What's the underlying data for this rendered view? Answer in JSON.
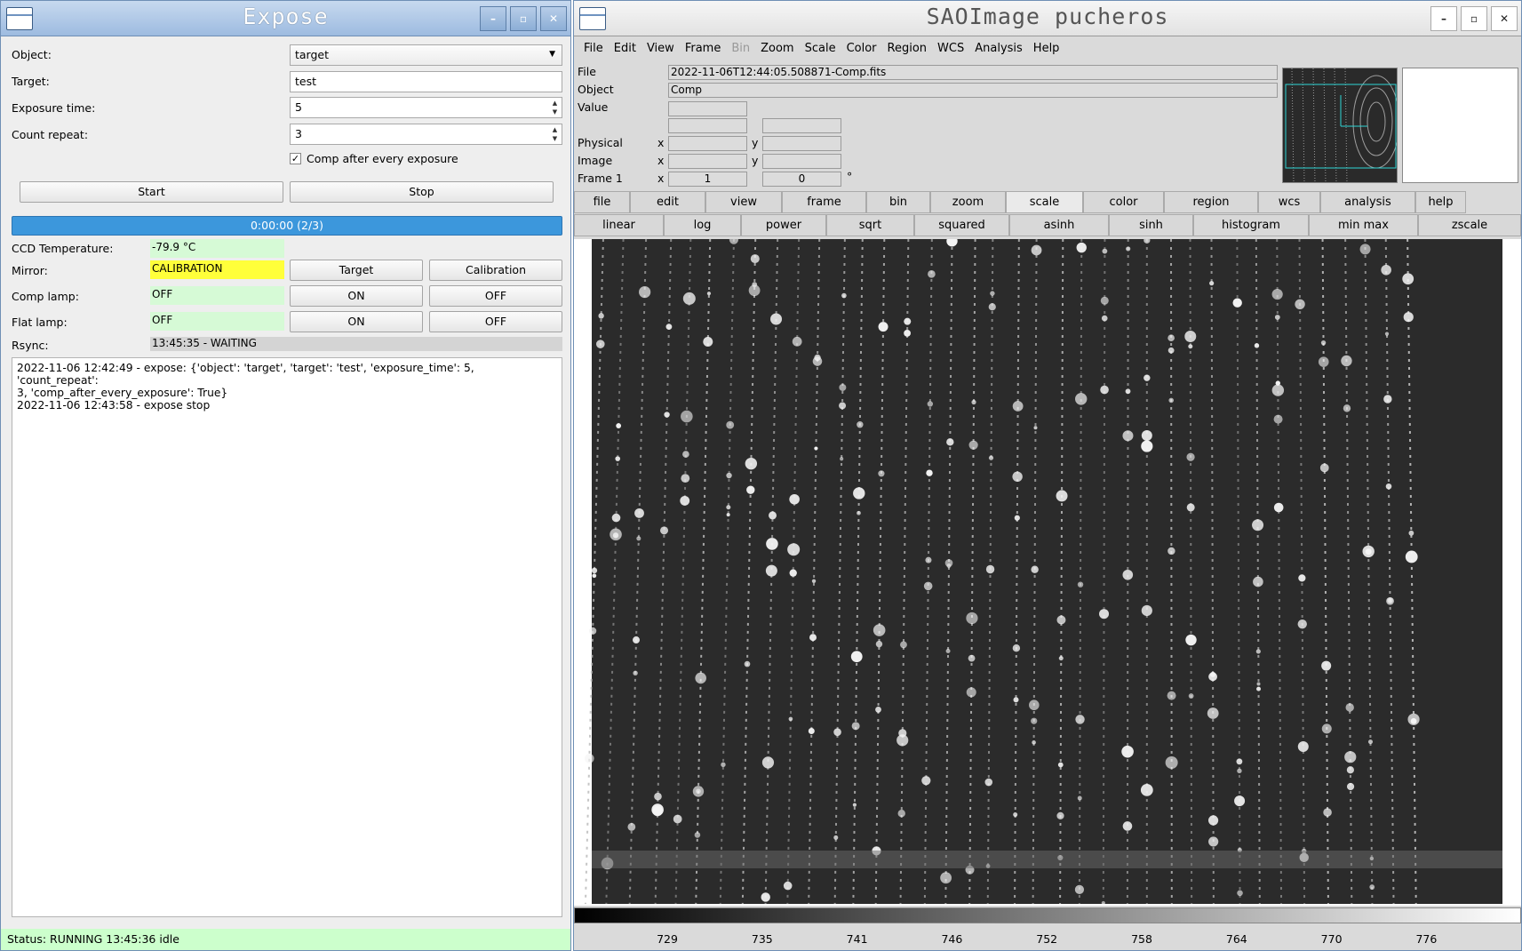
{
  "expose": {
    "title": "Expose",
    "form": {
      "object_label": "Object:",
      "object_value": "target",
      "target_label": "Target:",
      "target_value": "test",
      "exposure_label": "Exposure time:",
      "exposure_value": "5",
      "count_label": "Count repeat:",
      "count_value": "3",
      "comp_label": "Comp after every exposure",
      "comp_checked": true
    },
    "start_label": "Start",
    "stop_label": "Stop",
    "progress_text": "0:00:00 (2/3)",
    "progress_fraction": 1.0,
    "status_rows": {
      "ccd_label": "CCD Temperature:",
      "ccd_value": "-79.9 °C",
      "mirror_label": "Mirror:",
      "mirror_value": "CALIBRATION",
      "mirror_btn1": "Target",
      "mirror_btn2": "Calibration",
      "comp_label": "Comp lamp:",
      "comp_value": "OFF",
      "comp_on": "ON",
      "comp_off": "OFF",
      "flat_label": "Flat lamp:",
      "flat_value": "OFF",
      "flat_on": "ON",
      "flat_off": "OFF",
      "rsync_label": "Rsync:",
      "rsync_value": "13:45:35 - WAITING"
    },
    "log_text": "2022-11-06 12:42:49 - expose: {'object': 'target', 'target': 'test', 'exposure_time': 5, 'count_repeat':\n3, 'comp_after_every_exposure': True}\n2022-11-06 12:43:58 - expose stop",
    "status_bar": "Status: RUNNING 13:45:36 idle",
    "colors": {
      "progress": "#3c97dc",
      "green": "#d6fad6",
      "yellow": "#ffff3a"
    }
  },
  "ds9": {
    "title": "SAOImage pucheros",
    "menu": [
      "File",
      "Edit",
      "View",
      "Frame",
      "Bin",
      "Zoom",
      "Scale",
      "Color",
      "Region",
      "WCS",
      "Analysis",
      "Help"
    ],
    "menu_disabled": "Bin",
    "info": {
      "file_label": "File",
      "file_value": "2022-11-06T12:44:05.508871-Comp.fits",
      "object_label": "Object",
      "object_value": "Comp",
      "value_label": "Value",
      "physical_label": "Physical",
      "image_label": "Image",
      "frame_label": "Frame 1",
      "x_label": "x",
      "y_label": "y",
      "frame_x": "1",
      "frame_y": "0",
      "degree": "°"
    },
    "buttons_row1": [
      "file",
      "edit",
      "view",
      "frame",
      "bin",
      "zoom",
      "scale",
      "color",
      "region",
      "wcs",
      "analysis",
      "help"
    ],
    "buttons_row1_active": "scale",
    "buttons_row2": [
      "linear",
      "log",
      "power",
      "sqrt",
      "squared",
      "asinh",
      "sinh",
      "histogram",
      "min max",
      "zscale"
    ],
    "colorbar_ticks": [
      "729",
      "735",
      "741",
      "746",
      "752",
      "758",
      "764",
      "770",
      "776"
    ]
  }
}
